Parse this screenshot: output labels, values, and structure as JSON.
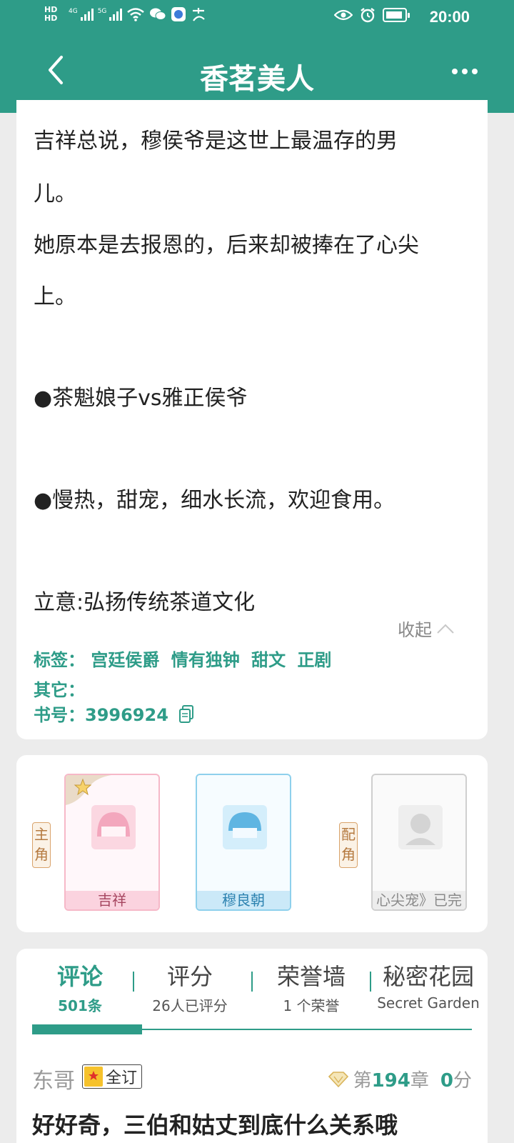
{
  "status_bar": {
    "hd1": "HD",
    "hd2": "HD",
    "net1": "4G",
    "net2": "5G",
    "time": "20:00"
  },
  "header": {
    "title": "香茗美人"
  },
  "description": {
    "lines": [
      "吉祥总说，穆侯爷是这世上最温存的男",
      "儿。",
      "她原本是去报恩的，后来却被捧在了心尖",
      "上。",
      "●茶魁娘子vs雅正侯爷",
      "●慢热，甜宠，细水长流，欢迎食用。",
      "立意:弘扬传统茶道文化"
    ],
    "collapse_label": "收起"
  },
  "meta": {
    "tags_label": "标签：",
    "tags": [
      "宫廷侯爵",
      "情有独钟",
      "甜文",
      "正剧"
    ],
    "other_label": "其它：",
    "book_no_label": "书号：",
    "book_no": "3996924"
  },
  "roles": {
    "main_label": "主角",
    "support_label": "配角",
    "characters": [
      {
        "name": "吉祥",
        "color": "#f3a7bd"
      },
      {
        "name": "穆良朝",
        "color": "#7ec8e8"
      },
      {
        "name": "心尖宠》已完",
        "color": "#cfcfcf"
      }
    ]
  },
  "tabs": [
    {
      "title": "评论",
      "sub": "501条"
    },
    {
      "title": "评分",
      "sub": "26人已评分"
    },
    {
      "title": "荣誉墙",
      "sub": "1 个荣誉"
    },
    {
      "title": "秘密花园",
      "sub": "Secret Garden"
    }
  ],
  "comment": {
    "user": "东哥",
    "badge": "全订",
    "chapter_prefix": "第",
    "chapter_num": "194",
    "chapter_suffix": "章",
    "score": "0",
    "score_suffix": "分",
    "text": "好好奇，三伯和姑丈到底什么关系哦"
  },
  "colors": {
    "brand": "#2e9c88",
    "badge": "#f6c22c"
  }
}
